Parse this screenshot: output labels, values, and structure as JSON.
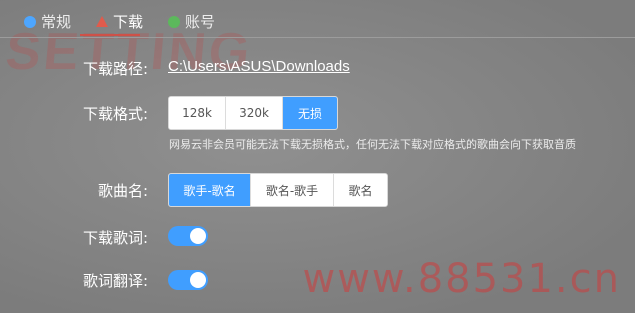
{
  "tabs": [
    {
      "label": "常规",
      "icon": "circle-icon",
      "color": "#4da6ff"
    },
    {
      "label": "下载",
      "icon": "triangle-icon",
      "color": "#e05b4c",
      "active": true
    },
    {
      "label": "账号",
      "icon": "circle-icon",
      "color": "#5cb85c"
    }
  ],
  "watermarks": {
    "top": "SETTING",
    "bottom": "www.88531.cn"
  },
  "settings": {
    "path": {
      "label": "下载路径:",
      "value": "C:\\Users\\ASUS\\Downloads"
    },
    "format": {
      "label": "下载格式:",
      "options": [
        "128k",
        "320k",
        "无损"
      ],
      "selected": "无损",
      "hint": "网易云非会员可能无法下载无损格式，任何无法下载对应格式的歌曲会向下获取音质"
    },
    "songname": {
      "label": "歌曲名:",
      "options": [
        "歌手-歌名",
        "歌名-歌手",
        "歌名"
      ],
      "selected": "歌手-歌名"
    },
    "lyrics": {
      "label": "下载歌词:",
      "enabled": true
    },
    "translate": {
      "label": "歌词翻译:",
      "enabled": true
    }
  },
  "colors": {
    "accent": "#409eff",
    "tab_active": "#ce5148"
  }
}
